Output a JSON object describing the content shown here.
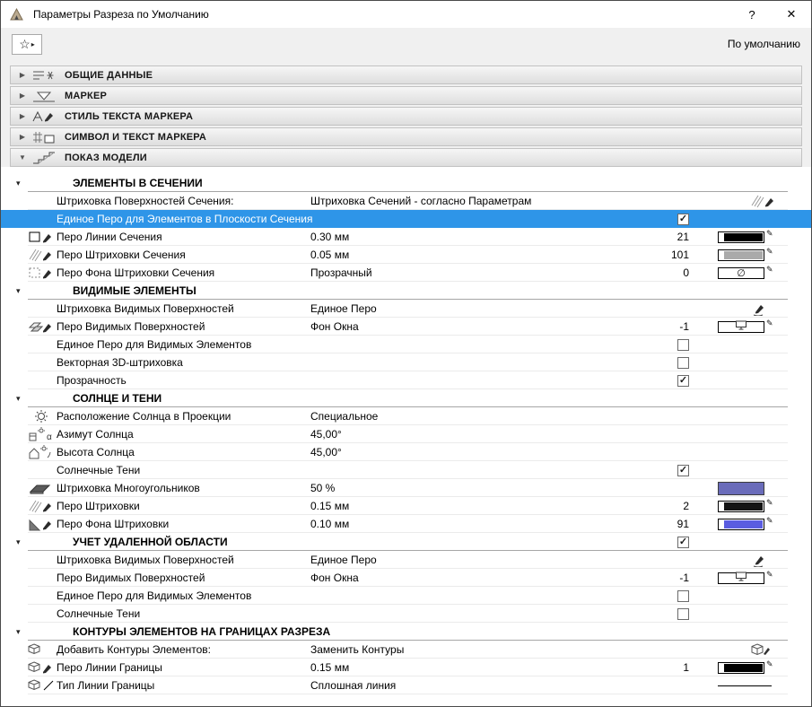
{
  "window": {
    "title": "Параметры Разреза по Умолчанию",
    "help_label": "?",
    "close_label": "✕"
  },
  "toolbar": {
    "default_label": "По умолчанию"
  },
  "colors": {
    "selection": "#2e95e8"
  },
  "icons": {
    "star": "☆",
    "menu_arrow": "▸",
    "check": "✓",
    "group_collapse": "▾",
    "section_collapsed": "▶",
    "section_expanded": "▼",
    "pen_marker": "✎"
  },
  "sections": [
    {
      "label": "ОБЩИЕ ДАННЫЕ",
      "icon": "general-data-icon",
      "expanded": false
    },
    {
      "label": "МАРКЕР",
      "icon": "marker-icon",
      "expanded": false
    },
    {
      "label": "СТИЛЬ ТЕКСТА МАРКЕРА",
      "icon": "marker-text-style-icon",
      "expanded": false
    },
    {
      "label": "СИМВОЛ И ТЕКСТ МАРКЕРА",
      "icon": "marker-symbol-icon",
      "expanded": false
    },
    {
      "label": "ПОКАЗ МОДЕЛИ",
      "icon": "model-display-icon",
      "expanded": true
    }
  ],
  "model_display": {
    "groups": [
      {
        "title": "ЭЛЕМЕНТЫ В СЕЧЕНИИ",
        "rows": [
          {
            "label": "Штриховка Поверхностей Сечения:",
            "value": "Штриховка Сечений - согласно Параметрам",
            "end": {
              "type": "icon",
              "icon": "hatch-pen-icon"
            }
          },
          {
            "label": "Единое Перо для Элементов в Плоскости Сечения",
            "selected": true,
            "pen_col": {
              "type": "checkbox",
              "checked": true
            }
          },
          {
            "icon": "section-line-pen-icon",
            "label": "Перо Линии Сечения",
            "value": "0.30 мм",
            "pen_col": {
              "type": "number",
              "value": "21"
            },
            "end": {
              "type": "pen-swatch",
              "color": "#000000"
            }
          },
          {
            "icon": "section-hatch-pen-icon",
            "label": "Перо Штриховки Сечения",
            "value": "0.05 мм",
            "pen_col": {
              "type": "number",
              "value": "101"
            },
            "end": {
              "type": "pen-swatch",
              "color": "#aaaaaa"
            }
          },
          {
            "icon": "section-hatch-bg-pen-icon",
            "label": "Перо Фона Штриховки Сечения",
            "value": "Прозрачный",
            "pen_col": {
              "type": "number",
              "value": "0"
            },
            "end": {
              "type": "pen-swatch-empty",
              "symbol": "∅"
            }
          }
        ]
      },
      {
        "title": "ВИДИМЫЕ ЭЛЕМЕНТЫ",
        "rows": [
          {
            "label": "Штриховка Видимых Поверхностей",
            "value": "Единое Перо",
            "end": {
              "type": "icon",
              "icon": "uniform-pen-icon"
            }
          },
          {
            "icon": "visible-surfaces-pen-icon",
            "label": "Перо Видимых Поверхностей",
            "value": "Фон Окна",
            "pen_col": {
              "type": "number",
              "value": "-1"
            },
            "end": {
              "type": "pen-swatch-screen"
            }
          },
          {
            "label": "Единое Перо для Видимых Элементов",
            "pen_col": {
              "type": "checkbox",
              "checked": false
            }
          },
          {
            "label": "Векторная 3D-штриховка",
            "pen_col": {
              "type": "checkbox",
              "checked": false
            }
          },
          {
            "label": "Прозрачность",
            "pen_col": {
              "type": "checkbox",
              "checked": true
            }
          }
        ]
      },
      {
        "title": "СОЛНЦЕ И ТЕНИ",
        "rows": [
          {
            "icon": "sun-icon",
            "label": "Расположение Солнца в Проекции",
            "value": "Специальное"
          },
          {
            "icon": "sun-azimuth-icon",
            "label": "Азимут Солнца",
            "value": "45,00°"
          },
          {
            "icon": "sun-altitude-icon",
            "label": "Высота Солнца",
            "value": "45,00°"
          },
          {
            "label": "Солнечные Тени",
            "pen_col": {
              "type": "checkbox",
              "checked": true
            }
          },
          {
            "icon": "shadow-polygon-icon",
            "label": "Штриховка Многоугольников",
            "value": "50 %",
            "end": {
              "type": "fill-swatch",
              "color": "#6a6cba"
            }
          },
          {
            "icon": "shadow-hatch-pen-icon",
            "label": "Перо Штриховки",
            "value": "0.15 мм",
            "pen_col": {
              "type": "number",
              "value": "2"
            },
            "end": {
              "type": "pen-swatch",
              "color": "#141414"
            }
          },
          {
            "icon": "shadow-fill-pen-icon",
            "label": "Перо Фона Штриховки",
            "value": "0.10 мм",
            "pen_col": {
              "type": "number",
              "value": "91"
            },
            "end": {
              "type": "pen-swatch",
              "color": "#5a5de0"
            }
          }
        ]
      },
      {
        "title": "УЧЕТ УДАЛЕННОЙ ОБЛАСТИ",
        "header_checkbox": {
          "checked": true
        },
        "rows": [
          {
            "label": "Штриховка Видимых Поверхностей",
            "value": "Единое Перо",
            "end": {
              "type": "icon",
              "icon": "uniform-pen-icon"
            }
          },
          {
            "label": "Перо Видимых Поверхностей",
            "value": "Фон Окна",
            "pen_col": {
              "type": "number",
              "value": "-1"
            },
            "end": {
              "type": "pen-swatch-screen"
            }
          },
          {
            "label": "Единое Перо для Видимых Элементов",
            "pen_col": {
              "type": "checkbox",
              "checked": false
            }
          },
          {
            "label": "Солнечные Тени",
            "pen_col": {
              "type": "checkbox",
              "checked": false
            }
          }
        ]
      },
      {
        "title": "КОНТУРЫ ЭЛЕМЕНТОВ НА ГРАНИЦАХ РАЗРЕЗА",
        "rows": [
          {
            "icon": "element-contours-icon",
            "label": "Добавить Контуры Элементов:",
            "value": "Заменить Контуры",
            "end": {
              "type": "icon",
              "icon": "replace-contours-icon"
            }
          },
          {
            "icon": "boundary-line-pen-icon",
            "label": "Перо Линии Границы",
            "value": "0.15 мм",
            "pen_col": {
              "type": "number",
              "value": "1"
            },
            "end": {
              "type": "pen-swatch",
              "color": "#000000"
            }
          },
          {
            "icon": "boundary-line-type-icon",
            "label": "Тип Линии Границы",
            "value": "Сплошная линия",
            "end": {
              "type": "line-sample"
            }
          }
        ]
      }
    ]
  }
}
